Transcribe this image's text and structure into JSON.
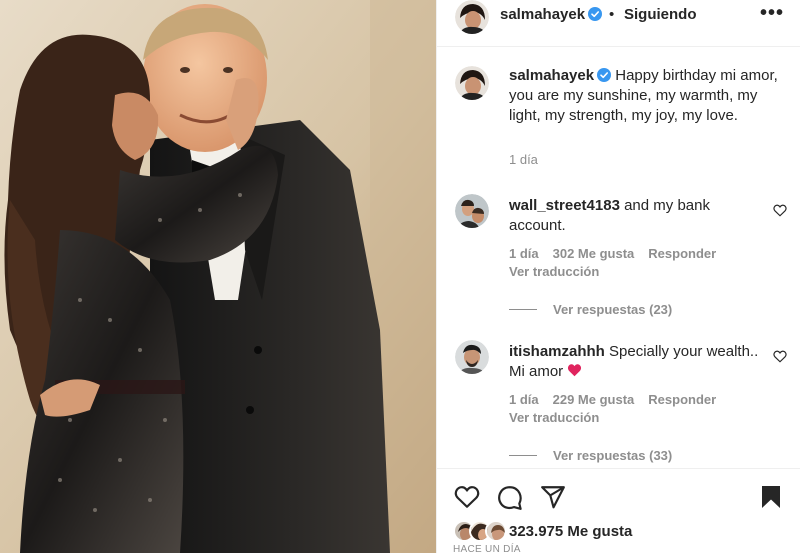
{
  "header": {
    "username": "salmahayek",
    "separator": "•",
    "follow_status": "Siguiendo",
    "more": "•••"
  },
  "caption": {
    "username": "salmahayek",
    "text": "Happy birthday mi amor, you are my sunshine, my warmth, my light, my strength, my joy, my love.",
    "time": "1 día"
  },
  "comments": [
    {
      "username": "wall_street4183",
      "text": "and my bank account.",
      "time": "1 día",
      "likes": "302 Me gusta",
      "reply": "Responder",
      "translate": "Ver traducción",
      "replies": "Ver respuestas (23)"
    },
    {
      "username": "itishamzahhh",
      "text": "Specially your wealth.. Mi amor",
      "time": "1 día",
      "likes": "229 Me gusta",
      "reply": "Responder",
      "translate": "Ver traducción",
      "replies": "Ver respuestas (33)"
    }
  ],
  "footer": {
    "likes": "323.975 Me gusta",
    "time_ago": "HACE UN DÍA"
  },
  "icons": {
    "like": "heart-icon",
    "comment": "comment-icon",
    "share": "share-icon",
    "save": "bookmark-icon",
    "verified": "verified-badge-icon"
  },
  "colors": {
    "text": "#262626",
    "secondary": "#8e8e8e",
    "verified": "#3897f0",
    "heart_emoji": "#e0245e",
    "border": "#efefef"
  }
}
